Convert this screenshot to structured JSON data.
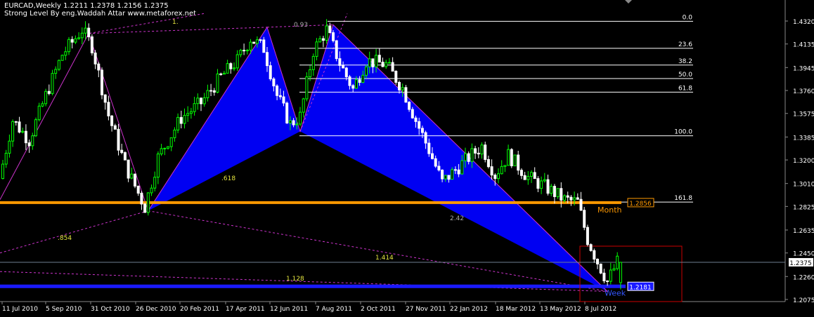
{
  "header": {
    "symbol_line": "EURCAD,Weekly  1.2211 1.2378 1.2156 1.2375",
    "indicator_line": "Strong Level By eng.Waddah Attar www.metaforex.net"
  },
  "chart_data": {
    "type": "candlestick",
    "title": "EURCAD,Weekly",
    "ohlc": {
      "open": 1.2211,
      "high": 1.2378,
      "low": 1.2156,
      "close": 1.2375
    },
    "ylim": [
      1.2075,
      1.432
    ],
    "y_ticks": [
      "1.4320",
      "1.4135",
      "1.3945",
      "1.3760",
      "1.3575",
      "1.3385",
      "1.3200",
      "1.3010",
      "1.2825",
      "1.2635",
      "1.2450",
      "1.2260",
      "1.2075"
    ],
    "x_ticks": [
      "11 Jul 2010",
      "5 Sep 2010",
      "31 Oct 2010",
      "26 Dec 2010",
      "20 Feb 2011",
      "17 Apr 2011",
      "12 Jun 2011",
      "7 Aug 2011",
      "2 Oct 2011",
      "27 Nov 2011",
      "22 Jan 2012",
      "18 Mar 2012",
      "13 May 2012",
      "8 Jul 2012"
    ],
    "current_price_label": "1.2375",
    "fibonacci": [
      {
        "label": "0.0",
        "price": 1.4318
      },
      {
        "label": "23.6",
        "price": 1.41
      },
      {
        "label": "38.2",
        "price": 1.3965
      },
      {
        "label": "50.0",
        "price": 1.3856
      },
      {
        "label": "61.8",
        "price": 1.3747
      },
      {
        "label": "100.0",
        "price": 1.3395
      },
      {
        "label": "161.8",
        "price": 1.286
      }
    ],
    "strong_levels": [
      {
        "label": "Month",
        "value_label": "1.2856",
        "price": 1.2856,
        "color": "#ff9900"
      },
      {
        "label": "Week",
        "value_label": "1.2181",
        "price": 1.2181,
        "color": "#1a1aff"
      }
    ],
    "pattern_ratio_labels": [
      "1.",
      "0.93",
      ".618",
      ".854",
      "2.42",
      "1.414",
      "1.128"
    ],
    "colors": {
      "bull": "#00ff00",
      "bear": "#ffffff",
      "pattern_fill": "#0000ff",
      "month_level": "#ff9900",
      "week_level": "#1a1aff",
      "fib": "#ffffff",
      "zigzag": "#cc33cc",
      "box": "#cc0000"
    }
  }
}
